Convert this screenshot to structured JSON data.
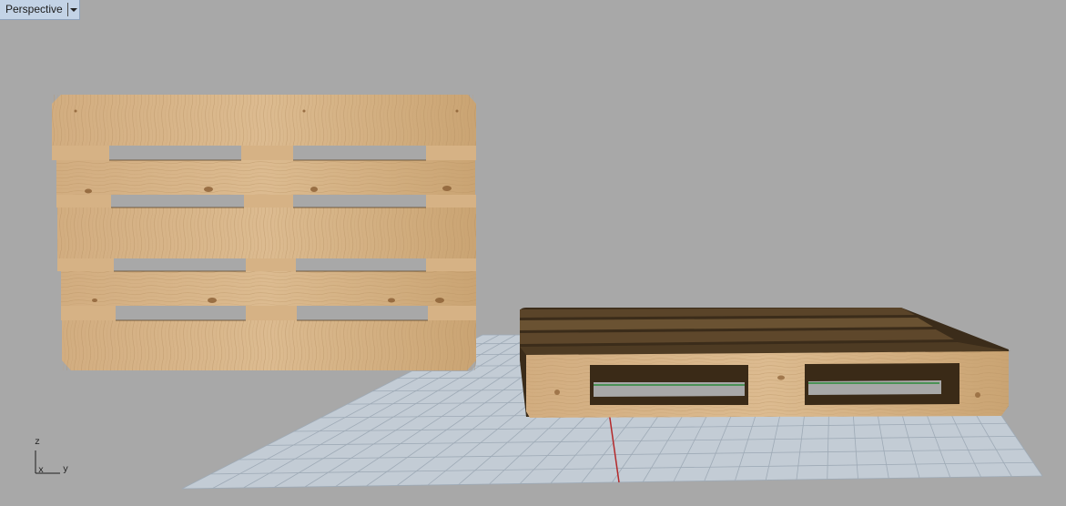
{
  "viewport": {
    "name": "Perspective",
    "menu_icon": "chevron-down-icon"
  },
  "axes": {
    "z": "z",
    "x": "x",
    "y": "y"
  },
  "colors": {
    "background": "#a8a8a8",
    "grid": "#bcc5cf",
    "wood_light": "#d7b488",
    "wood_dark": "#4a3620",
    "x_axis": "#b4282a",
    "y_axis": "#2c8a3a"
  }
}
